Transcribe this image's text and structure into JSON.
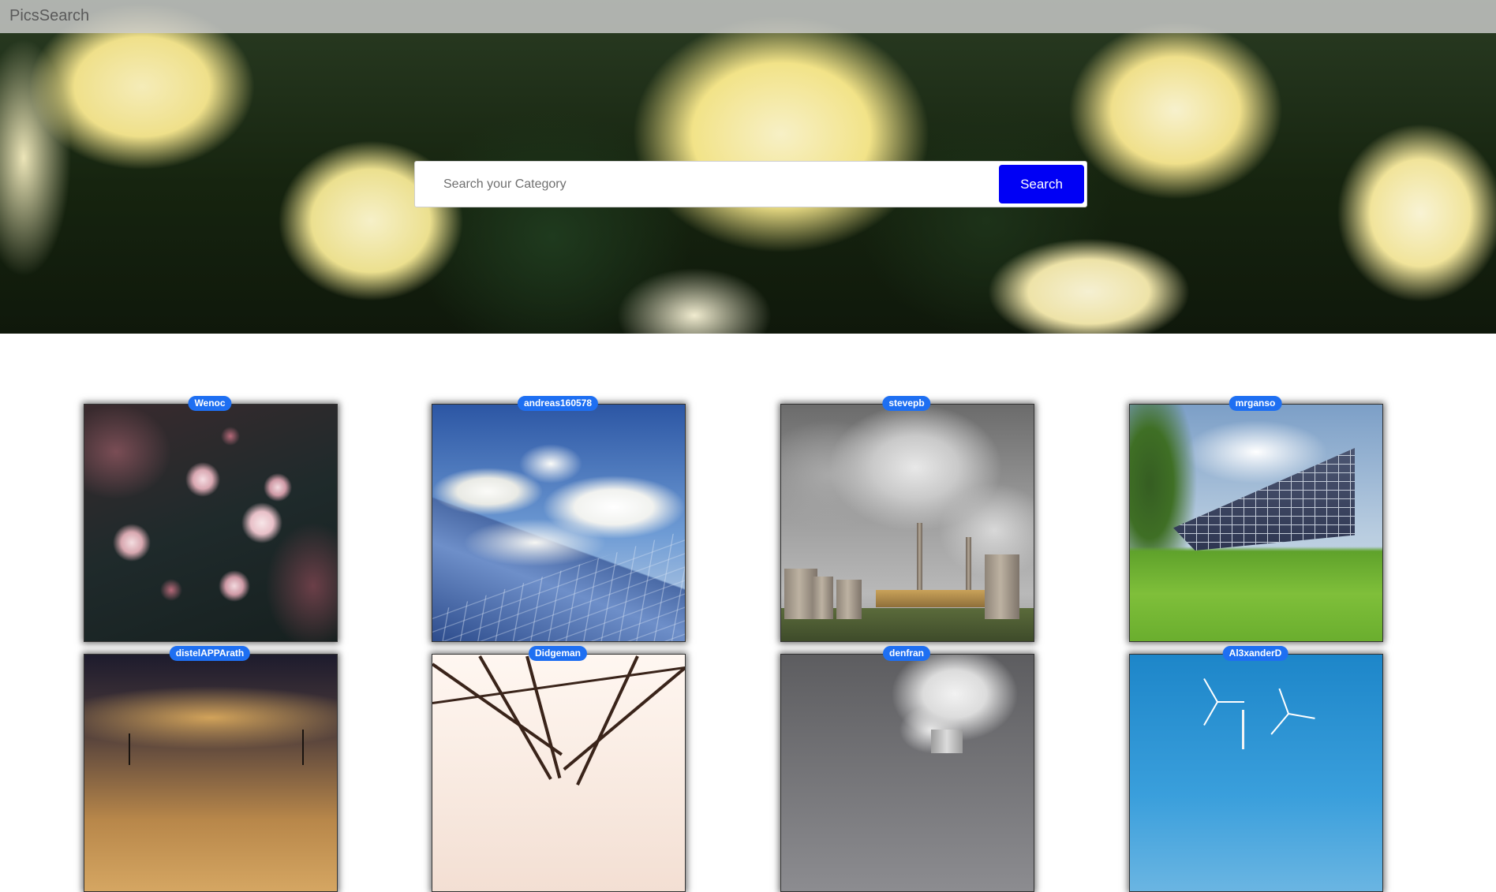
{
  "header": {
    "brand": "PicsSearch"
  },
  "search": {
    "placeholder": "Search your Category",
    "value": "",
    "button_label": "Search",
    "button_color": "#0000f5"
  },
  "badge_color": "#1e6ff2",
  "gallery": {
    "images": [
      {
        "author": "Wenoc",
        "subject": "pink cherry blossoms on dark branch"
      },
      {
        "author": "andreas160578",
        "subject": "solar panels under blue sky with clouds"
      },
      {
        "author": "stevepb",
        "subject": "power plant cooling towers with smoke"
      },
      {
        "author": "mrganso",
        "subject": "solar panel array on green field"
      },
      {
        "author": "distelAPPArath",
        "subject": "wind turbines at sunset"
      },
      {
        "author": "Didgeman",
        "subject": "electricity pylon structure"
      },
      {
        "author": "denfran",
        "subject": "cooling tower smoke"
      },
      {
        "author": "Al3xanderD",
        "subject": "wind turbines against blue sky"
      }
    ]
  }
}
